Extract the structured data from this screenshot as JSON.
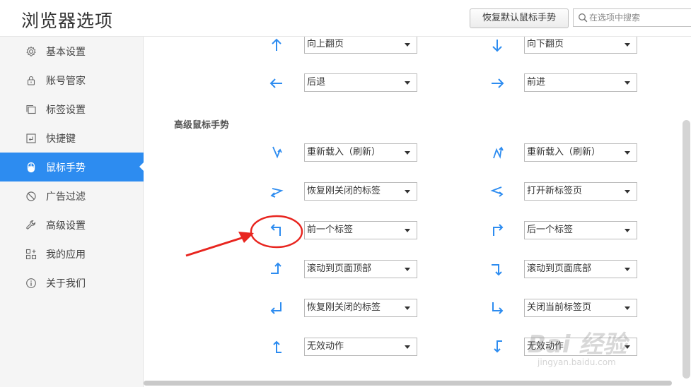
{
  "header": {
    "title": "浏览器选项",
    "restore_button": "恢复默认鼠标手势",
    "search_placeholder": "在选项中搜索"
  },
  "sidebar": {
    "items": [
      {
        "label": "基本设置",
        "icon": "gear-icon",
        "active": false
      },
      {
        "label": "账号管家",
        "icon": "lock-icon",
        "active": false
      },
      {
        "label": "标签设置",
        "icon": "tabs-icon",
        "active": false
      },
      {
        "label": "快捷键",
        "icon": "keyboard-icon",
        "active": false
      },
      {
        "label": "鼠标手势",
        "icon": "mouse-icon",
        "active": true
      },
      {
        "label": "广告过滤",
        "icon": "block-icon",
        "active": false
      },
      {
        "label": "高级设置",
        "icon": "wrench-icon",
        "active": false
      },
      {
        "label": "我的应用",
        "icon": "apps-icon",
        "active": false
      },
      {
        "label": "关于我们",
        "icon": "info-icon",
        "active": false
      }
    ]
  },
  "basic_gestures": [
    {
      "left": {
        "gesture": "up-arrow-icon",
        "action": "向上翻页"
      },
      "right": {
        "gesture": "down-arrow-icon",
        "action": "向下翻页"
      }
    },
    {
      "left": {
        "gesture": "left-arrow-icon",
        "action": "后退"
      },
      "right": {
        "gesture": "right-arrow-icon",
        "action": "前进"
      }
    }
  ],
  "advanced_title": "高级鼠标手势",
  "advanced_gestures": [
    {
      "left": {
        "gesture": "down-up-gesture-icon",
        "action": "重新载入（刷新）"
      },
      "right": {
        "gesture": "up-down-gesture-icon",
        "action": "重新载入（刷新）"
      }
    },
    {
      "left": {
        "gesture": "right-left-gesture-icon",
        "action": "恢复刚关闭的标签"
      },
      "right": {
        "gesture": "left-right-gesture-icon",
        "action": "打开新标签页"
      }
    },
    {
      "left": {
        "gesture": "up-left-gesture-icon",
        "action": "前一个标签"
      },
      "right": {
        "gesture": "up-right-gesture-icon",
        "action": "后一个标签"
      }
    },
    {
      "left": {
        "gesture": "right-up-gesture-icon",
        "action": "滚动到页面顶部"
      },
      "right": {
        "gesture": "right-down-gesture-icon",
        "action": "滚动到页面底部"
      }
    },
    {
      "left": {
        "gesture": "up-left-down-gesture-icon",
        "action": "恢复刚关闭的标签"
      },
      "right": {
        "gesture": "down-right-gesture-icon",
        "action": "关闭当前标签页"
      }
    },
    {
      "left": {
        "gesture": "left-up-gesture-icon",
        "action": "无效动作"
      },
      "right": {
        "gesture": "left-down-gesture-icon",
        "action": "无效动作"
      }
    }
  ],
  "watermark": {
    "brand": "Bai 经验",
    "url": "jingyan.baidu.com"
  },
  "colors": {
    "accent": "#2d8cf0",
    "annotation": "#e8251f"
  }
}
